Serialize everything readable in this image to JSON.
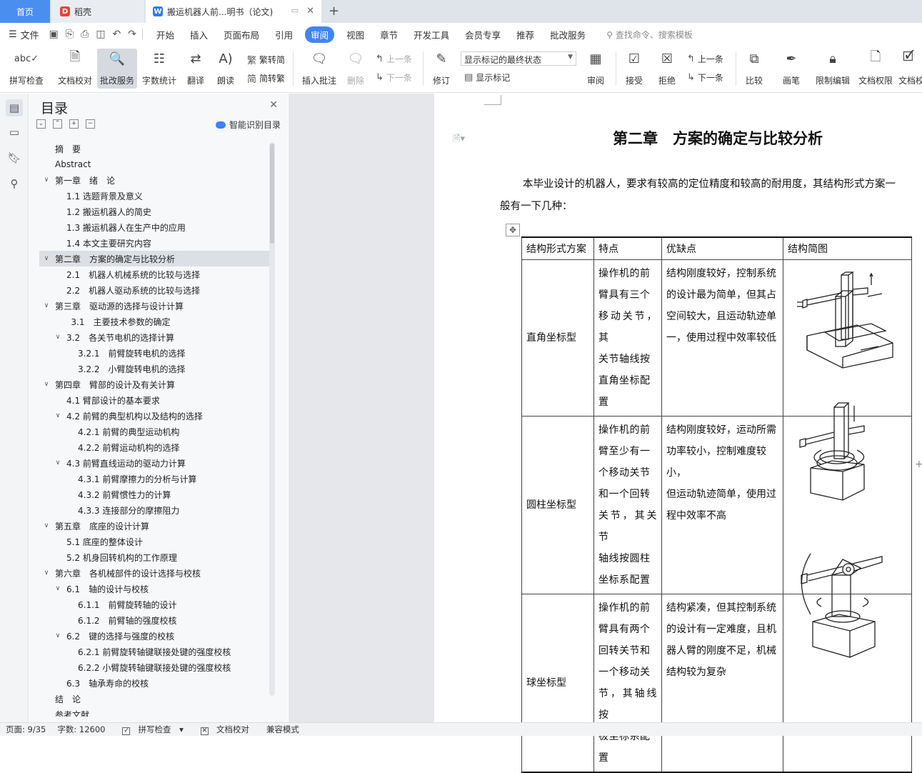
{
  "tabs": {
    "home": "首页",
    "daoke": "稻壳",
    "doc": "搬运机器人前...明书（论文)"
  },
  "menu": {
    "file": "文件",
    "items": [
      "开始",
      "插入",
      "页面布局",
      "引用",
      "审阅",
      "视图",
      "章节",
      "开发工具",
      "会员专享",
      "推荐",
      "批改服务"
    ],
    "active_index": 4,
    "search": "查找命令、搜索模板"
  },
  "ribbon": {
    "spell": "拼写检查",
    "proof": "文档校对",
    "review_service": "批改服务",
    "word_count": "字数统计",
    "translate": "翻译",
    "read_aloud": "朗读",
    "trad": "繁转简",
    "simp": "简转繁",
    "insert_comment": "插入批注",
    "delete": "删除",
    "prev": "上一条",
    "next": "下一条",
    "revise": "修订",
    "markup_state": "显示标记的最终状态",
    "show_markup": "显示标记",
    "review": "审阅",
    "accept": "接受",
    "reject": "拒绝",
    "prev2": "上一条",
    "next2": "下一条",
    "compare": "比较",
    "ink": "画笔",
    "restrict": "限制编辑",
    "doc_perm": "文档权限",
    "doc_check": "文档校"
  },
  "toc": {
    "title": "目录",
    "smart": "智能识别目录",
    "items": [
      {
        "text": "摘　要",
        "level": 0,
        "chev": ""
      },
      {
        "text": "Abstract",
        "level": 0,
        "chev": ""
      },
      {
        "text": "第一章　绪　论",
        "level": 0,
        "chev": "v"
      },
      {
        "text": "1.1 选题背景及意义",
        "level": 1,
        "chev": ""
      },
      {
        "text": "1.2  搬运机器人的简史",
        "level": 1,
        "chev": ""
      },
      {
        "text": "1.3 搬运机器人在生产中的应用",
        "level": 1,
        "chev": ""
      },
      {
        "text": "1.4 本文主要研究内容",
        "level": 1,
        "chev": ""
      },
      {
        "text": "第二章　方案的确定与比较分析",
        "level": 0,
        "chev": "v",
        "selected": true
      },
      {
        "text": "2.1　机器人机械系统的比较与选择",
        "level": 1,
        "chev": ""
      },
      {
        "text": "2.2　机器人驱动系统的比较与选择",
        "level": 1,
        "chev": ""
      },
      {
        "text": "第三章　驱动源的选择与设计计算",
        "level": 0,
        "chev": "v"
      },
      {
        "text": "3.1　主要技术参数的确定",
        "level": 1.4,
        "chev": ""
      },
      {
        "text": "3.2　各关节电机的选择计算",
        "level": 1,
        "chev": "v"
      },
      {
        "text": "3.2.1　前臂旋转电机的选择",
        "level": 2,
        "chev": ""
      },
      {
        "text": "3.2.2　小臂旋转电机的选择",
        "level": 2,
        "chev": ""
      },
      {
        "text": "第四章　臂部的设计及有关计算",
        "level": 0,
        "chev": "v"
      },
      {
        "text": "4.1  臂部设计的基本要求",
        "level": 1,
        "chev": ""
      },
      {
        "text": "4.2  前臂的典型机构以及结构的选择",
        "level": 1,
        "chev": "v"
      },
      {
        "text": "4.2.1  前臂的典型运动机构",
        "level": 2,
        "chev": ""
      },
      {
        "text": "4.2.2  前臂运动机构的选择",
        "level": 2,
        "chev": ""
      },
      {
        "text": "4.3  前臂直线运动的驱动力计算",
        "level": 1,
        "chev": "v"
      },
      {
        "text": "4.3.1  前臂摩擦力的分析与计算",
        "level": 2,
        "chev": ""
      },
      {
        "text": "4.3.2  前臂惯性力的计算",
        "level": 2,
        "chev": ""
      },
      {
        "text": "4.3.3 连接部分的摩擦阻力",
        "level": 2,
        "chev": ""
      },
      {
        "text": "第五章　底座的设计计算",
        "level": 0,
        "chev": "v"
      },
      {
        "text": "5.1  底座的整体设计",
        "level": 1,
        "chev": ""
      },
      {
        "text": "5.2  机身回转机构的工作原理",
        "level": 1,
        "chev": ""
      },
      {
        "text": "第六章　各机械部件的设计选择与校核",
        "level": 0,
        "chev": "v"
      },
      {
        "text": "6.1　轴的设计与校核",
        "level": 1,
        "chev": "v"
      },
      {
        "text": "6.1.1　前臂旋转轴的设计",
        "level": 2,
        "chev": ""
      },
      {
        "text": "6.1.2　前臂轴的强度校核",
        "level": 2,
        "chev": ""
      },
      {
        "text": "6.2　键的选择与强度的校核",
        "level": 1,
        "chev": "v"
      },
      {
        "text": "6.2.1 前臂旋转轴键联接处键的强度校核",
        "level": 2,
        "chev": ""
      },
      {
        "text": "6.2.2 小臂旋转轴键联接处键的强度校核",
        "level": 2,
        "chev": ""
      },
      {
        "text": "6.3　轴承寿命的校核",
        "level": 1,
        "chev": ""
      },
      {
        "text": "结　论",
        "level": 0,
        "chev": ""
      },
      {
        "text": "参考文献",
        "level": 0,
        "chev": ""
      }
    ]
  },
  "document": {
    "chapter_title": "第二章　方案的确定与比较分析",
    "para_line1": "本毕业设计的机器人，要求有较高的定位精度和较高的耐用度，其结构形式方案一",
    "para_line2": "般有一下几种：",
    "table": {
      "headers": [
        "结构形式方案",
        "特点",
        "优缺点",
        "结构简图"
      ],
      "rows": [
        {
          "name": "直角坐标型",
          "feature": [
            "操作机的前",
            "臂具有三个",
            "移动关节，其",
            "关节轴线按",
            "直角坐标配",
            "置"
          ],
          "pros": [
            "结构刚度较好，控制系统",
            "的设计最为简单，但其占",
            "空间较大，且运动轨迹单",
            "一，使用过程中效率较低"
          ]
        },
        {
          "name": "圆柱坐标型",
          "feature": [
            "操作机的前",
            "臂至少有一",
            "个移动关节",
            "和一个回转",
            "关节，其关节",
            "轴线按圆柱",
            "坐标系配置"
          ],
          "pros": [
            "结构刚度较好，运动所需",
            "功率较小，控制难度较小，",
            "但运动轨迹简单，使用过",
            "程中效率不高"
          ]
        },
        {
          "name": "球坐标型",
          "feature": [
            "操作机的前",
            "臂具有两个",
            "回转关节和",
            "一个移动关",
            "节，其轴线按",
            "极坐标系配",
            "置"
          ],
          "pros": [
            "结构紧凑，但其控制系统",
            "的设计有一定难度，且机",
            "器人臂的刚度不足，机械",
            "结构较为复杂"
          ]
        }
      ]
    }
  },
  "status": {
    "page": "页面: 9/35",
    "words": "字数: 12600",
    "spell": "拼写检查",
    "proof": "文档校对",
    "compat": "兼容模式"
  },
  "colors": {
    "accent": "#3f86f1",
    "home_tab": "#4a8ef0",
    "wps_red": "#e0463b",
    "wps_blue": "#2f7bf0"
  }
}
